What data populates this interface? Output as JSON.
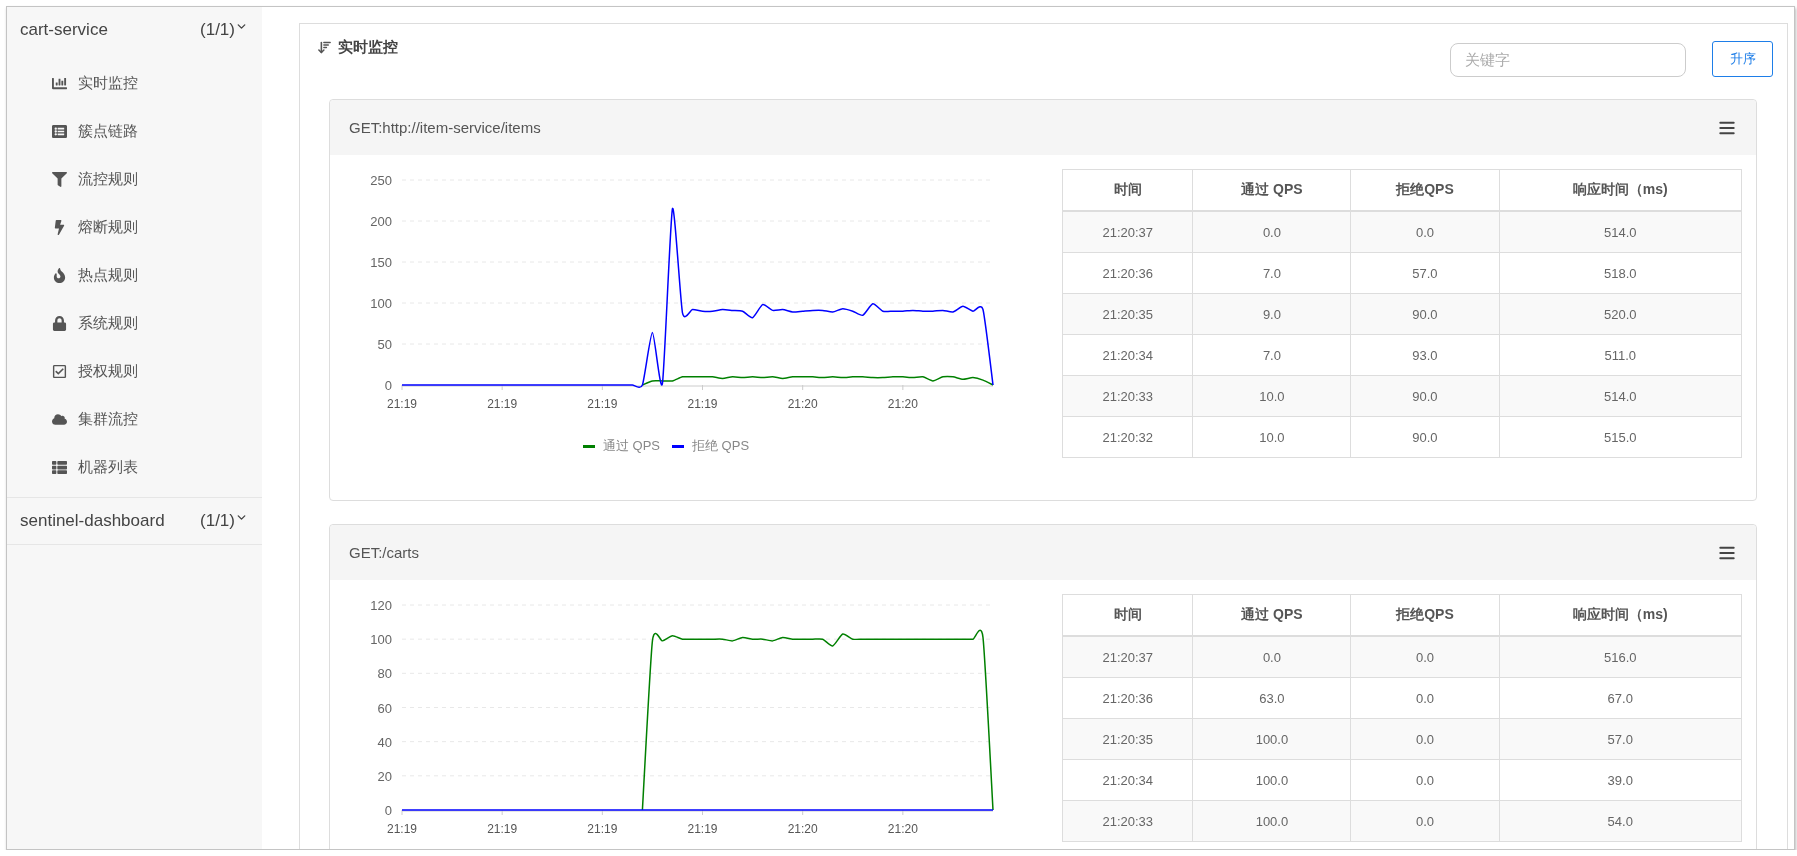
{
  "sidebar": {
    "groups": [
      {
        "name": "cart-service",
        "count": "(1/1)",
        "expanded": true,
        "items": [
          {
            "label": "实时监控",
            "selected": false
          },
          {
            "label": "簇点链路",
            "selected": false
          },
          {
            "label": "流控规则",
            "selected": false
          },
          {
            "label": "熔断规则",
            "selected": false
          },
          {
            "label": "热点规则",
            "selected": false
          },
          {
            "label": "系统规则",
            "selected": false
          },
          {
            "label": "授权规则",
            "selected": false
          },
          {
            "label": "集群流控",
            "selected": false
          },
          {
            "label": "机器列表",
            "selected": false
          }
        ]
      },
      {
        "name": "sentinel-dashboard",
        "count": "(1/1)",
        "expanded": false
      }
    ]
  },
  "panel": {
    "title": "实时监控",
    "search": {
      "placeholder": "关键字"
    },
    "sort_button": "升序"
  },
  "cards": [
    {
      "title": "GET:http://item-service/items",
      "chart_data": {
        "type": "line",
        "categories": [
          "21:19",
          null,
          null,
          null,
          null,
          null,
          null,
          null,
          null,
          null,
          "21:19",
          null,
          null,
          null,
          null,
          null,
          null,
          null,
          null,
          null,
          "21:19",
          null,
          null,
          null,
          null,
          null,
          null,
          null,
          null,
          null,
          "21:19",
          null,
          null,
          null,
          null,
          null,
          null,
          null,
          null,
          null,
          "21:20",
          null,
          null,
          null,
          null,
          null,
          null,
          null,
          null,
          null,
          "21:20",
          null,
          null,
          null,
          null,
          null,
          null,
          null,
          null,
          null
        ],
        "ylim": [
          0,
          250
        ],
        "yticks": [
          0,
          50,
          100,
          150,
          200,
          250
        ],
        "grid": true,
        "series": [
          {
            "name": "通过 QPS",
            "color": "#008000",
            "values": [
              null,
              null,
              null,
              null,
              null,
              null,
              null,
              null,
              null,
              null,
              null,
              null,
              null,
              null,
              null,
              null,
              null,
              null,
              null,
              null,
              null,
              null,
              null,
              null,
              0,
              5,
              5,
              5,
              10,
              10,
              10,
              10,
              8,
              10,
              9,
              10,
              9,
              10,
              8,
              10,
              10,
              10,
              9,
              10,
              9,
              10,
              10,
              9,
              9,
              10,
              10,
              9,
              10,
              5,
              10,
              10,
              7,
              9,
              6,
              0
            ]
          },
          {
            "name": "拒绝 QPS",
            "color": "#0000ff",
            "values": [
              0,
              0,
              0,
              0,
              0,
              0,
              0,
              0,
              0,
              0,
              0,
              0,
              0,
              0,
              0,
              0,
              0,
              0,
              0,
              0,
              0,
              0,
              0,
              0,
              0,
              64,
              2,
              215,
              88,
              92,
              90,
              90,
              92,
              91,
              90,
              82,
              98,
              91,
              92,
              89,
              90,
              91,
              91,
              89,
              93,
              90,
              85,
              99,
              90,
              90,
              90,
              91,
              90,
              90,
              91,
              89,
              96,
              90,
              92,
              0
            ]
          }
        ]
      },
      "table": {
        "columns": [
          "时间",
          "通过 QPS",
          "拒绝QPS",
          "响应时间（ms)"
        ],
        "rows": [
          [
            "21:20:37",
            "0.0",
            "0.0",
            "514.0"
          ],
          [
            "21:20:36",
            "7.0",
            "57.0",
            "518.0"
          ],
          [
            "21:20:35",
            "9.0",
            "90.0",
            "520.0"
          ],
          [
            "21:20:34",
            "7.0",
            "93.0",
            "511.0"
          ],
          [
            "21:20:33",
            "10.0",
            "90.0",
            "514.0"
          ],
          [
            "21:20:32",
            "10.0",
            "90.0",
            "515.0"
          ]
        ]
      }
    },
    {
      "title": "GET:/carts",
      "chart_data": {
        "type": "line",
        "categories": [
          "21:19",
          null,
          null,
          null,
          null,
          null,
          null,
          null,
          null,
          null,
          "21:19",
          null,
          null,
          null,
          null,
          null,
          null,
          null,
          null,
          null,
          "21:19",
          null,
          null,
          null,
          null,
          null,
          null,
          null,
          null,
          null,
          "21:19",
          null,
          null,
          null,
          null,
          null,
          null,
          null,
          null,
          null,
          "21:20",
          null,
          null,
          null,
          null,
          null,
          null,
          null,
          null,
          null,
          "21:20",
          null,
          null,
          null,
          null,
          null,
          null,
          null,
          null,
          null
        ],
        "ylim": [
          0,
          120
        ],
        "yticks": [
          0,
          20,
          40,
          60,
          80,
          100,
          120
        ],
        "grid": true,
        "series": [
          {
            "color": "#008000",
            "values": [
              null,
              null,
              null,
              null,
              null,
              null,
              null,
              null,
              null,
              null,
              null,
              null,
              null,
              null,
              null,
              null,
              null,
              null,
              null,
              null,
              null,
              null,
              null,
              null,
              0,
              99,
              99,
              102,
              100,
              100,
              100,
              100,
              100,
              99,
              101,
              100,
              100,
              99,
              101,
              100,
              100,
              100,
              100,
              96,
              103,
              100,
              100,
              100,
              100,
              100,
              100,
              100,
              100,
              100,
              100,
              100,
              100,
              100,
              101,
              0
            ]
          },
          {
            "color": "#0000ff",
            "values": [
              0,
              0,
              0,
              0,
              0,
              0,
              0,
              0,
              0,
              0,
              0,
              0,
              0,
              0,
              0,
              0,
              0,
              0,
              0,
              0,
              0,
              0,
              0,
              0,
              0,
              0,
              0,
              0,
              0,
              0,
              0,
              0,
              0,
              0,
              0,
              0,
              0,
              0,
              0,
              0,
              0,
              0,
              0,
              0,
              0,
              0,
              0,
              0,
              0,
              0,
              0,
              0,
              0,
              0,
              0,
              0,
              0,
              0,
              0,
              0
            ]
          }
        ]
      },
      "table": {
        "columns": [
          "时间",
          "通过 QPS",
          "拒绝QPS",
          "响应时间（ms)"
        ],
        "rows": [
          [
            "21:20:37",
            "0.0",
            "0.0",
            "516.0"
          ],
          [
            "21:20:36",
            "63.0",
            "0.0",
            "67.0"
          ],
          [
            "21:20:35",
            "100.0",
            "0.0",
            "57.0"
          ],
          [
            "21:20:34",
            "100.0",
            "0.0",
            "39.0"
          ],
          [
            "21:20:33",
            "100.0",
            "0.0",
            "54.0"
          ]
        ]
      }
    }
  ]
}
